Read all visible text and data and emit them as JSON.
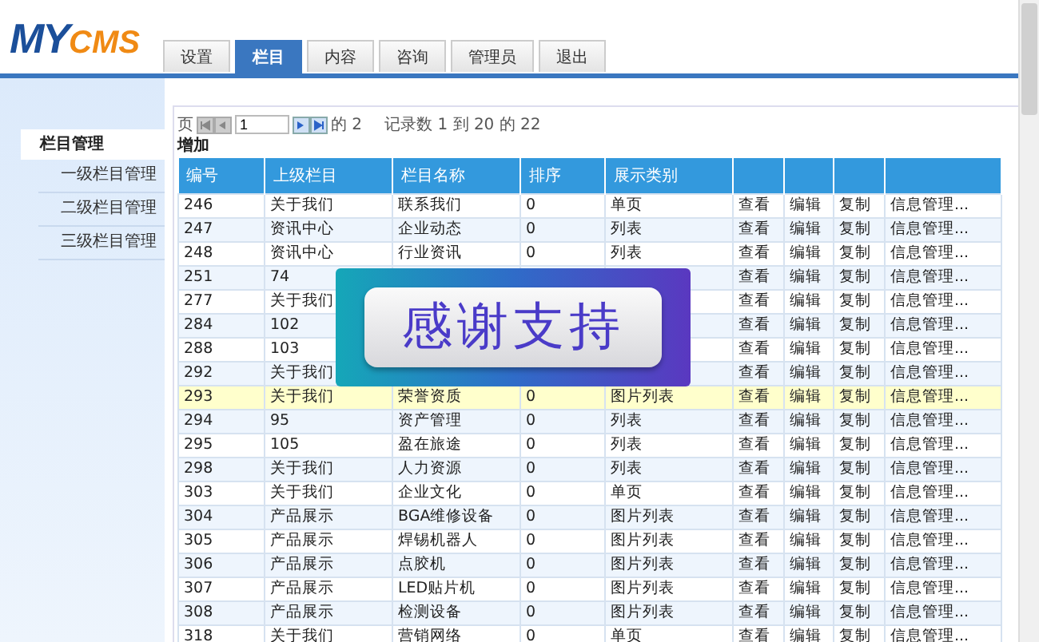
{
  "logo": {
    "first": "MY",
    "second": "CMS"
  },
  "tabs": [
    {
      "label": "设置",
      "selected": false
    },
    {
      "label": "栏目",
      "selected": true
    },
    {
      "label": "内容",
      "selected": false
    },
    {
      "label": "咨询",
      "selected": false
    },
    {
      "label": "管理员",
      "selected": false
    },
    {
      "label": "退出",
      "selected": false
    }
  ],
  "sidebar": {
    "title": "栏目管理",
    "items": [
      "一级栏目管理",
      "二级栏目管理",
      "三级栏目管理"
    ]
  },
  "pager": {
    "page_label": "页",
    "page": "1",
    "of_pages": "的 2",
    "records": "记录数 1 到 20 的 22"
  },
  "add_link": "增加",
  "table": {
    "columns": [
      "编号",
      "上级栏目",
      "栏目名称",
      "排序",
      "展示类别"
    ],
    "rows": [
      {
        "cells": [
          "246",
          "关于我们",
          "联系我们",
          "0",
          "单页"
        ],
        "actions": [
          "查看",
          "编辑",
          "复制",
          "信息管理..."
        ],
        "selected": false
      },
      {
        "cells": [
          "247",
          "资讯中心",
          "企业动态",
          "0",
          "列表"
        ],
        "actions": [
          "查看",
          "编辑",
          "复制",
          "信息管理..."
        ],
        "selected": false
      },
      {
        "cells": [
          "248",
          "资讯中心",
          "行业资讯",
          "0",
          "列表"
        ],
        "actions": [
          "查看",
          "编辑",
          "复制",
          "信息管理..."
        ],
        "selected": false
      },
      {
        "cells": [
          "251",
          "74",
          null,
          null,
          null
        ],
        "actions": [
          "查看",
          "编辑",
          "复制",
          "信息管理..."
        ],
        "selected": false
      },
      {
        "cells": [
          "277",
          "关于我们",
          null,
          null,
          null
        ],
        "actions": [
          "查看",
          "编辑",
          "复制",
          "信息管理..."
        ],
        "selected": false
      },
      {
        "cells": [
          "284",
          "102",
          null,
          null,
          null
        ],
        "actions": [
          "查看",
          "编辑",
          "复制",
          "信息管理..."
        ],
        "selected": false
      },
      {
        "cells": [
          "288",
          "103",
          null,
          null,
          null
        ],
        "actions": [
          "查看",
          "编辑",
          "复制",
          "信息管理..."
        ],
        "selected": false
      },
      {
        "cells": [
          "292",
          "关于我们",
          null,
          null,
          null
        ],
        "actions": [
          "查看",
          "编辑",
          "复制",
          "信息管理..."
        ],
        "selected": false
      },
      {
        "cells": [
          "293",
          "关于我们",
          "荣誉资质",
          "0",
          "图片列表"
        ],
        "actions": [
          "查看",
          "编辑",
          "复制",
          "信息管理..."
        ],
        "selected": true
      },
      {
        "cells": [
          "294",
          "95",
          "资产管理",
          "0",
          "列表"
        ],
        "actions": [
          "查看",
          "编辑",
          "复制",
          "信息管理..."
        ],
        "selected": false
      },
      {
        "cells": [
          "295",
          "105",
          "盈在旅途",
          "0",
          "列表"
        ],
        "actions": [
          "查看",
          "编辑",
          "复制",
          "信息管理..."
        ],
        "selected": false
      },
      {
        "cells": [
          "298",
          "关于我们",
          "人力资源",
          "0",
          "列表"
        ],
        "actions": [
          "查看",
          "编辑",
          "复制",
          "信息管理..."
        ],
        "selected": false
      },
      {
        "cells": [
          "303",
          "关于我们",
          "企业文化",
          "0",
          "单页"
        ],
        "actions": [
          "查看",
          "编辑",
          "复制",
          "信息管理..."
        ],
        "selected": false
      },
      {
        "cells": [
          "304",
          "产品展示",
          "BGA维修设备",
          "0",
          "图片列表"
        ],
        "actions": [
          "查看",
          "编辑",
          "复制",
          "信息管理..."
        ],
        "selected": false
      },
      {
        "cells": [
          "305",
          "产品展示",
          "焊锡机器人",
          "0",
          "图片列表"
        ],
        "actions": [
          "查看",
          "编辑",
          "复制",
          "信息管理..."
        ],
        "selected": false
      },
      {
        "cells": [
          "306",
          "产品展示",
          "点胶机",
          "0",
          "图片列表"
        ],
        "actions": [
          "查看",
          "编辑",
          "复制",
          "信息管理..."
        ],
        "selected": false
      },
      {
        "cells": [
          "307",
          "产品展示",
          "LED贴片机",
          "0",
          "图片列表"
        ],
        "actions": [
          "查看",
          "编辑",
          "复制",
          "信息管理..."
        ],
        "selected": false
      },
      {
        "cells": [
          "308",
          "产品展示",
          "检测设备",
          "0",
          "图片列表"
        ],
        "actions": [
          "查看",
          "编辑",
          "复制",
          "信息管理..."
        ],
        "selected": false
      },
      {
        "cells": [
          "318",
          "关于我们",
          "营销网络",
          "0",
          "单页"
        ],
        "actions": [
          "查看",
          "编辑",
          "复制",
          "信息管理..."
        ],
        "selected": false
      }
    ]
  },
  "overlay_banner": "感谢支持"
}
